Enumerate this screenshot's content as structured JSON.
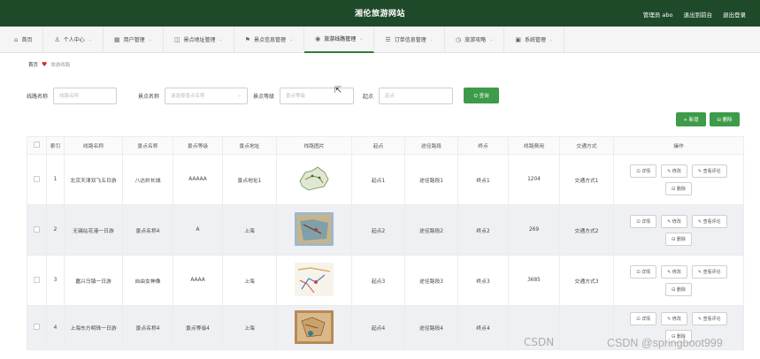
{
  "header": {
    "title": "湘伦旅游网站",
    "admin": "管理员 abo",
    "back_to_front": "退出到前台",
    "logout": "退出登录"
  },
  "menu": [
    {
      "icon": "home-icon",
      "glyph": "⌂",
      "label": "首页",
      "chevron": ""
    },
    {
      "icon": "person-icon",
      "glyph": "♙",
      "label": "个人中心",
      "chevron": "⌄"
    },
    {
      "icon": "grid-icon",
      "glyph": "▦",
      "label": "用户管理",
      "chevron": "⌄"
    },
    {
      "icon": "tag-icon",
      "glyph": "◫",
      "label": "景点地址管理",
      "chevron": "⌄"
    },
    {
      "icon": "flag-icon",
      "glyph": "⚑",
      "label": "景点信息管理",
      "chevron": "⌄"
    },
    {
      "icon": "pin-icon",
      "glyph": "◉",
      "label": "旅游线路管理",
      "chevron": "⌄"
    },
    {
      "icon": "list-icon",
      "glyph": "☰",
      "label": "订单信息管理",
      "chevron": "⌄"
    },
    {
      "icon": "clock-icon",
      "glyph": "◷",
      "label": "旅游攻略",
      "chevron": "⌄"
    },
    {
      "icon": "settings-icon",
      "glyph": "▣",
      "label": "系统管理",
      "chevron": "⌄"
    }
  ],
  "breadcrumb": {
    "home": "首页",
    "current": "旅游线路"
  },
  "search": {
    "route_label": "线路名称",
    "route_placeholder": "线路名称",
    "spot_label": "景点名称",
    "spot_placeholder": "请选择景点名称",
    "level_label": "景点等级",
    "level_placeholder": "景点等级",
    "start_label": "起点",
    "start_placeholder": "起点",
    "search_button": "Q 查询"
  },
  "actions": {
    "add": "+ 新增",
    "delete": "⊟ 删除"
  },
  "table": {
    "headers": [
      "",
      "索引",
      "线路名称",
      "景点名称",
      "景点等级",
      "景点地址",
      "线路图片",
      "起点",
      "途径路段",
      "终点",
      "线路费用",
      "交通方式",
      "操作"
    ],
    "rows": [
      {
        "index": "1",
        "route": "北京天津双飞五日游",
        "spot": "八达岭长城",
        "level": "AAAAA",
        "address": "景点地址1",
        "start": "起点1",
        "via": "途径路段1",
        "end": "终点1",
        "fee": "1204",
        "transport": "交通方式1"
      },
      {
        "index": "2",
        "route": "无锡站花港一日游",
        "spot": "景点名称4",
        "level": "A",
        "address": "上海",
        "start": "起点2",
        "via": "途径路段2",
        "end": "终点2",
        "fee": "269",
        "transport": "交通方式2"
      },
      {
        "index": "3",
        "route": "嘉兴乌镇一日游",
        "spot": "自由女神像",
        "level": "AAAA",
        "address": "上海",
        "start": "起点3",
        "via": "途径路段3",
        "end": "终点3",
        "fee": "3685",
        "transport": "交通方式3"
      },
      {
        "index": "4",
        "route": "上海东方明珠一日游",
        "spot": "景点名称4",
        "level": "景点等级4",
        "address": "上海",
        "start": "起点4",
        "via": "途径路段4",
        "end": "终点4",
        "fee": "",
        "transport": ""
      }
    ],
    "ops": {
      "detail": "⊡ 详情",
      "edit": "✎ 修改",
      "review": "✎ 查看评论",
      "delete": "⊟ 删除"
    }
  },
  "watermark": {
    "left": "CSDN",
    "right": "CSDN @springboot999"
  }
}
